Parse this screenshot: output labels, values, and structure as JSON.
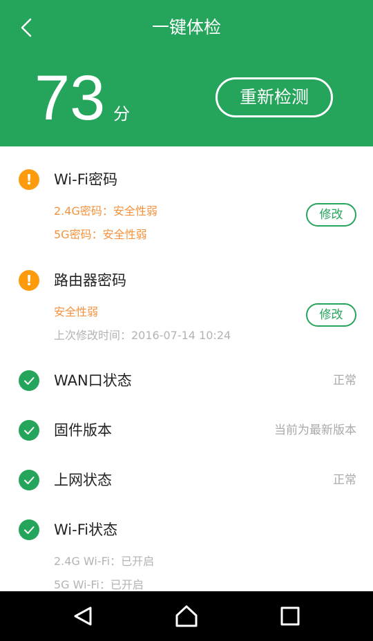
{
  "header": {
    "title": "一键体检",
    "score": "73",
    "score_unit": "分",
    "recheck_label": "重新检测"
  },
  "items": [
    {
      "status": "warning",
      "title": "Wi-Fi密码",
      "details": [
        "2.4G密码：安全性弱",
        "5G密码：安全性弱"
      ],
      "action_label": "修改"
    },
    {
      "status": "warning",
      "title": "路由器密码",
      "details": [
        "安全性弱",
        "上次修改时间：2016-07-14 10:24"
      ],
      "action_label": "修改"
    },
    {
      "status": "ok",
      "title": "WAN口状态",
      "value": "正常"
    },
    {
      "status": "ok",
      "title": "固件版本",
      "value": "当前为最新版本"
    },
    {
      "status": "ok",
      "title": "上网状态",
      "value": "正常"
    },
    {
      "status": "ok",
      "title": "Wi-Fi状态",
      "details": [
        "2.4G Wi-Fi：已开启",
        "5G Wi-Fi：已开启"
      ]
    }
  ],
  "icons": {
    "back": "chevron-left-icon",
    "warning": "exclamation-icon",
    "ok": "check-icon",
    "nav_back": "triangle-back-icon",
    "nav_home": "home-icon",
    "nav_recents": "square-recents-icon"
  },
  "colors": {
    "primary_green": "#25a45b",
    "warning_orange": "#fd9b0c",
    "warning_text": "#f5913c",
    "muted_text": "#a9a9a9"
  }
}
